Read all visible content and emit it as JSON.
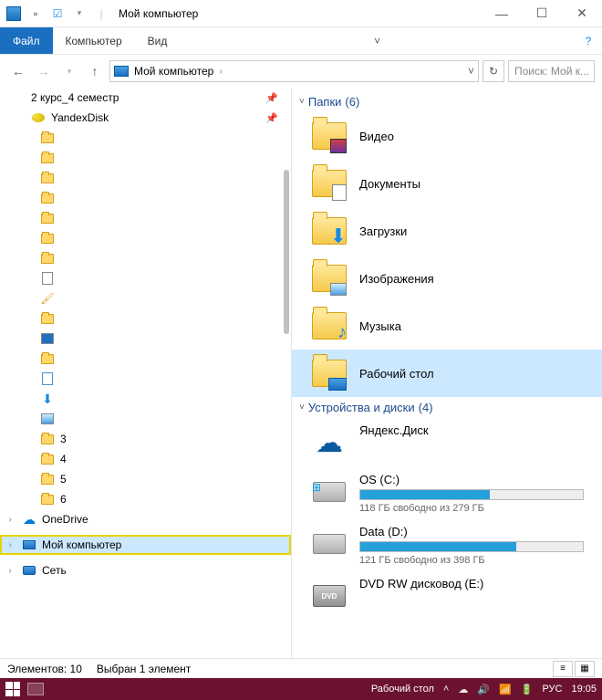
{
  "window": {
    "title": "Мой компьютер"
  },
  "ribbon": {
    "file": "Файл",
    "computer": "Компьютер",
    "view": "Вид"
  },
  "nav": {
    "address": "Мой компьютер",
    "search_placeholder": "Поиск: Мой к..."
  },
  "tree": {
    "course": "2 курс_4 семестр",
    "yandexdisk": "YandexDisk",
    "n3": "3",
    "n4": "4",
    "n5": "5",
    "n6": "6",
    "onedrive": "OneDrive",
    "mycomputer": "Мой компьютер",
    "network": "Сеть"
  },
  "sections": {
    "folders": {
      "label": "Папки",
      "count": "(6)"
    },
    "devices": {
      "label": "Устройства и диски",
      "count": "(4)"
    }
  },
  "folders": {
    "video": "Видео",
    "documents": "Документы",
    "downloads": "Загрузки",
    "images": "Изображения",
    "music": "Музыка",
    "desktop": "Рабочий стол"
  },
  "devices": {
    "yandex": "Яндекс.Диск",
    "os": {
      "name": "OS (C:)",
      "sub": "118 ГБ свободно из 279 ГБ",
      "fill": 58
    },
    "data": {
      "name": "Data (D:)",
      "sub": "121 ГБ свободно из 398 ГБ",
      "fill": 70
    },
    "dvd": "DVD RW дисковод (E:)"
  },
  "status": {
    "items": "Элементов: 10",
    "selected": "Выбран 1 элемент"
  },
  "taskbar": {
    "desktop_label": "Рабочий стол",
    "lang": "РУС",
    "time": "19:05"
  }
}
